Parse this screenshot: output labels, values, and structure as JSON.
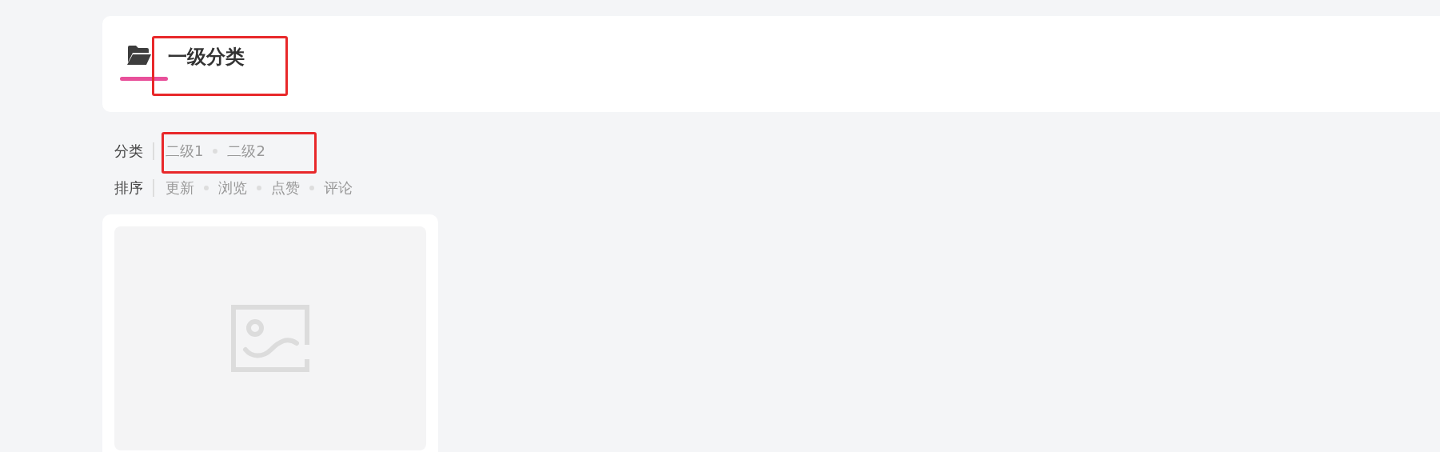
{
  "header": {
    "title": "一级分类"
  },
  "filters": [
    {
      "label": "分类",
      "options": [
        {
          "text": "二级1",
          "selected": false
        },
        {
          "text": "二级2",
          "selected": false
        }
      ]
    },
    {
      "label": "排序",
      "options": [
        {
          "text": "更新",
          "selected": false
        },
        {
          "text": "浏览",
          "selected": false
        },
        {
          "text": "点赞",
          "selected": false
        },
        {
          "text": "评论",
          "selected": false
        }
      ]
    }
  ],
  "cards": [
    {
      "kind": "placeholder"
    }
  ]
}
